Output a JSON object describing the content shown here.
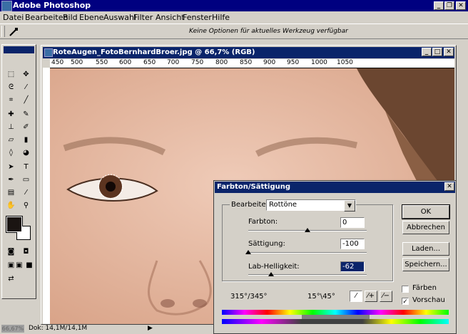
{
  "app": {
    "title": "Adobe Photoshop"
  },
  "menu": [
    "Datei",
    "Bearbeiten",
    "Bild",
    "Ebene",
    "Auswahl",
    "Filter",
    "Ansicht",
    "Fenster",
    "Hilfe"
  ],
  "options_bar": {
    "message": "Keine Optionen für aktuelles Werkzeug verfügbar"
  },
  "document": {
    "title": "RoteAugen_FotoBernhardBroer.jpg @ 66,7% (RGB)",
    "ruler_labels": [
      "450",
      "500",
      "550",
      "600",
      "650",
      "700",
      "750",
      "800",
      "850",
      "900",
      "950",
      "1000",
      "1050"
    ]
  },
  "status": {
    "zoom": "66,67%",
    "doc": "Dok: 14,1M/14,1M"
  },
  "dialog": {
    "title": "Farbton/Sättigung",
    "edit_label": "Bearbeiten:",
    "edit_value": "Rottöne",
    "sliders": [
      {
        "label": "Farbton:",
        "value": "0",
        "thumb_fraction": 0.5
      },
      {
        "label": "Sättigung:",
        "value": "-100",
        "thumb_fraction": 0.0
      },
      {
        "label": "Lab-Helligkeit:",
        "value": "-62",
        "thumb_fraction": 0.19
      }
    ],
    "range_left": "315°/345°",
    "range_right": "15°\\45°",
    "buttons": {
      "ok": "OK",
      "cancel": "Abbrechen",
      "load": "Laden...",
      "save": "Speichern..."
    },
    "checkboxes": {
      "colorize": {
        "label": "Färben",
        "checked": false
      },
      "preview": {
        "label": "Vorschau",
        "checked": true
      }
    }
  },
  "colors": {
    "title_bar": "#000080",
    "doc_title": "#0a246a",
    "red_eye": "#c0151c",
    "brown_eye": "#5c3420"
  }
}
